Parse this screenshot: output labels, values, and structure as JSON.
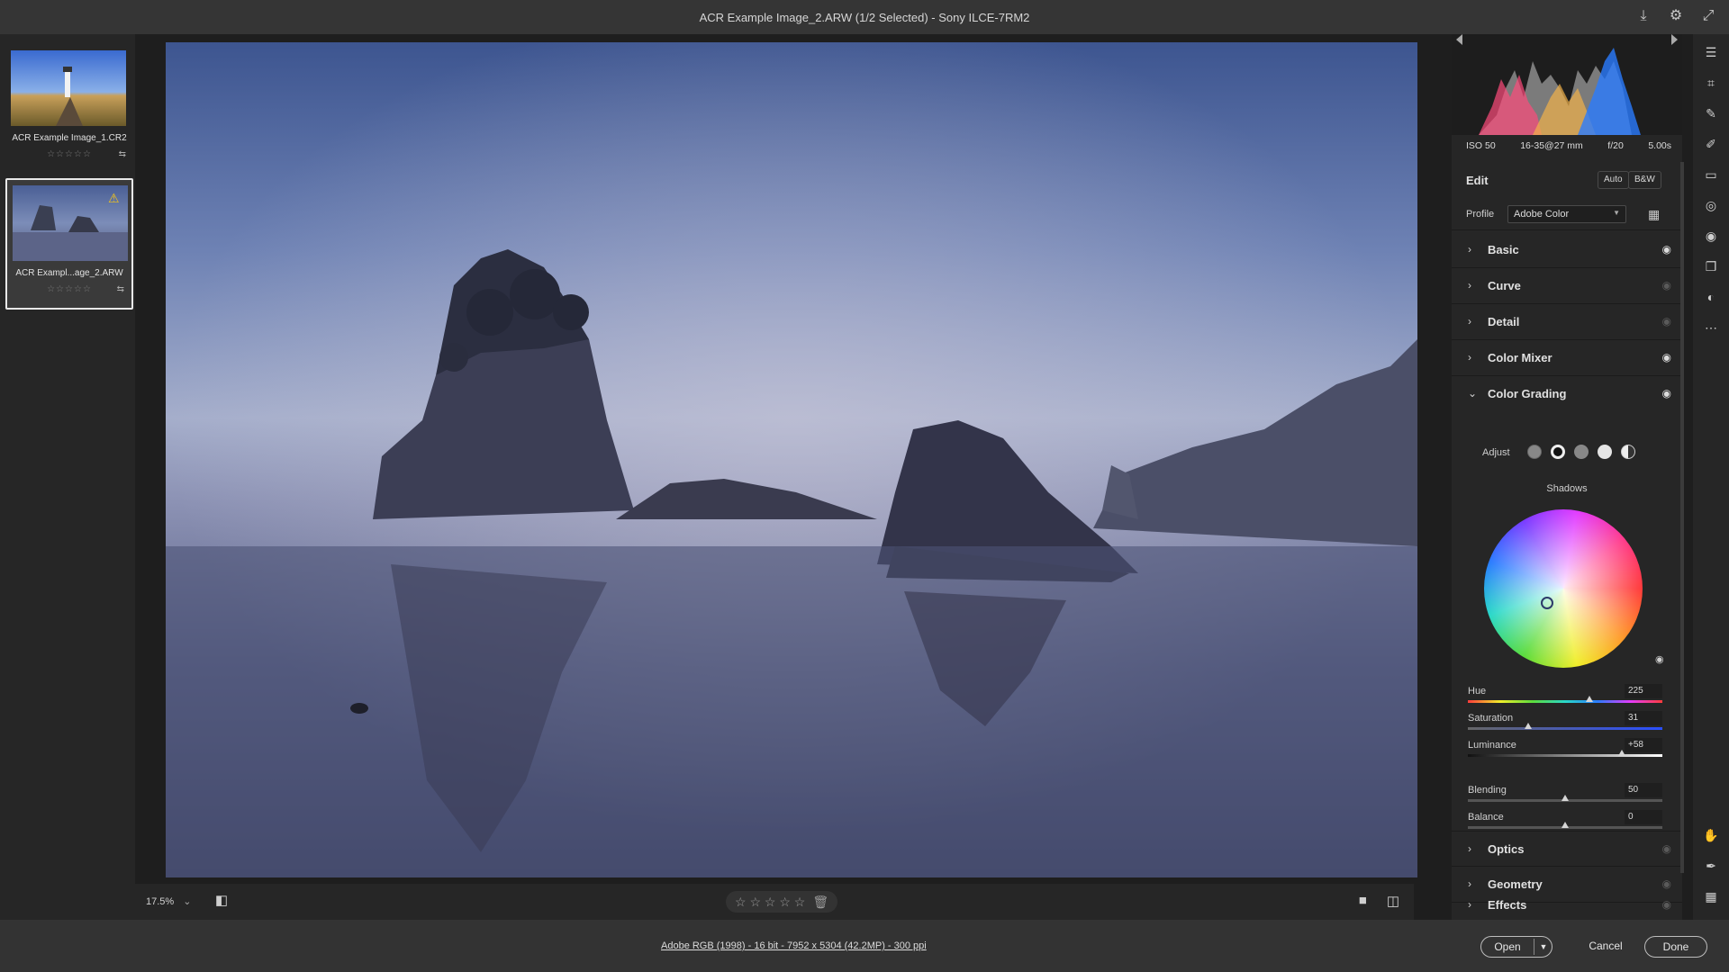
{
  "window": {
    "title": "ACR Example Image_2.ARW (1/2 Selected)  -  Sony ILCE-7RM2",
    "icons": [
      "save-icon",
      "settings-icon",
      "fullscreen-icon"
    ]
  },
  "filmstrip": [
    {
      "name": "ACR Example Image_1.CR2",
      "stars": "☆☆☆☆☆",
      "selected": false
    },
    {
      "name": "ACR Exampl...age_2.ARW",
      "stars": "☆☆☆☆☆",
      "selected": true,
      "warning": true
    }
  ],
  "exif": {
    "iso": "ISO 50",
    "lens": "16-35@27 mm",
    "aperture": "f/20",
    "shutter": "5.00s"
  },
  "edit": {
    "label": "Edit",
    "auto": "Auto",
    "bw": "B&W"
  },
  "profile": {
    "label": "Profile",
    "value": "Adobe Color"
  },
  "sections": {
    "basic": "Basic",
    "curve": "Curve",
    "detail": "Detail",
    "color_mixer": "Color Mixer",
    "color_grading": "Color Grading",
    "optics": "Optics",
    "geometry": "Geometry",
    "effects": "Effects"
  },
  "color_grading": {
    "adjust_label": "Adjust",
    "mode": "Shadows",
    "hue": {
      "label": "Hue",
      "value": "225",
      "pos": 0.625
    },
    "saturation": {
      "label": "Saturation",
      "value": "31",
      "pos": 0.31
    },
    "luminance": {
      "label": "Luminance",
      "value": "+58",
      "pos": 0.79
    },
    "blending": {
      "label": "Blending",
      "value": "50",
      "pos": 0.5
    },
    "balance": {
      "label": "Balance",
      "value": "0",
      "pos": 0.5
    }
  },
  "bottom": {
    "zoom": "17.5%",
    "stars": "☆ ☆ ☆ ☆ ☆"
  },
  "status": {
    "info": "Adobe RGB (1998) - 16 bit - 7952 x 5304 (42.2MP) - 300 ppi",
    "open": "Open",
    "cancel": "Cancel",
    "done": "Done"
  }
}
